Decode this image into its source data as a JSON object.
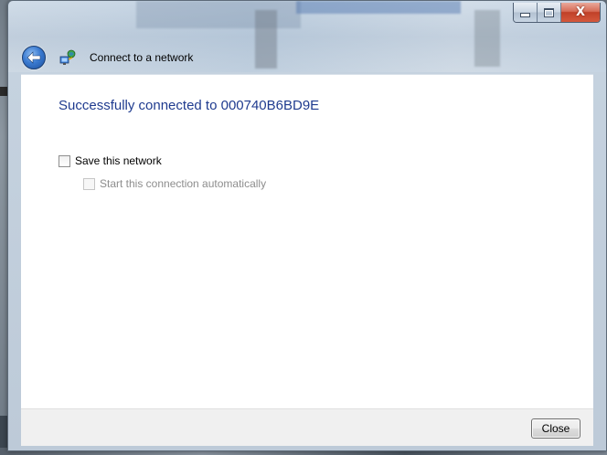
{
  "window": {
    "title": "Connect to a network",
    "caption_buttons": {
      "minimize_icon": "minimize-icon",
      "maximize_icon": "maximize-icon",
      "close_icon": "close-icon",
      "close_glyph": "X"
    },
    "back_icon": "back-arrow-icon",
    "network_icon": "network-connection-icon"
  },
  "content": {
    "heading": "Successfully connected to 000740B6BD9E",
    "options": [
      {
        "label": "Save this network",
        "checked": false,
        "enabled": true
      },
      {
        "label": "Start this connection automatically",
        "checked": false,
        "enabled": false
      }
    ]
  },
  "footer": {
    "close_label": "Close"
  },
  "colors": {
    "heading": "#1f3b8f",
    "disabled_text": "#8d8d8d",
    "close_caption": "#c04128"
  }
}
